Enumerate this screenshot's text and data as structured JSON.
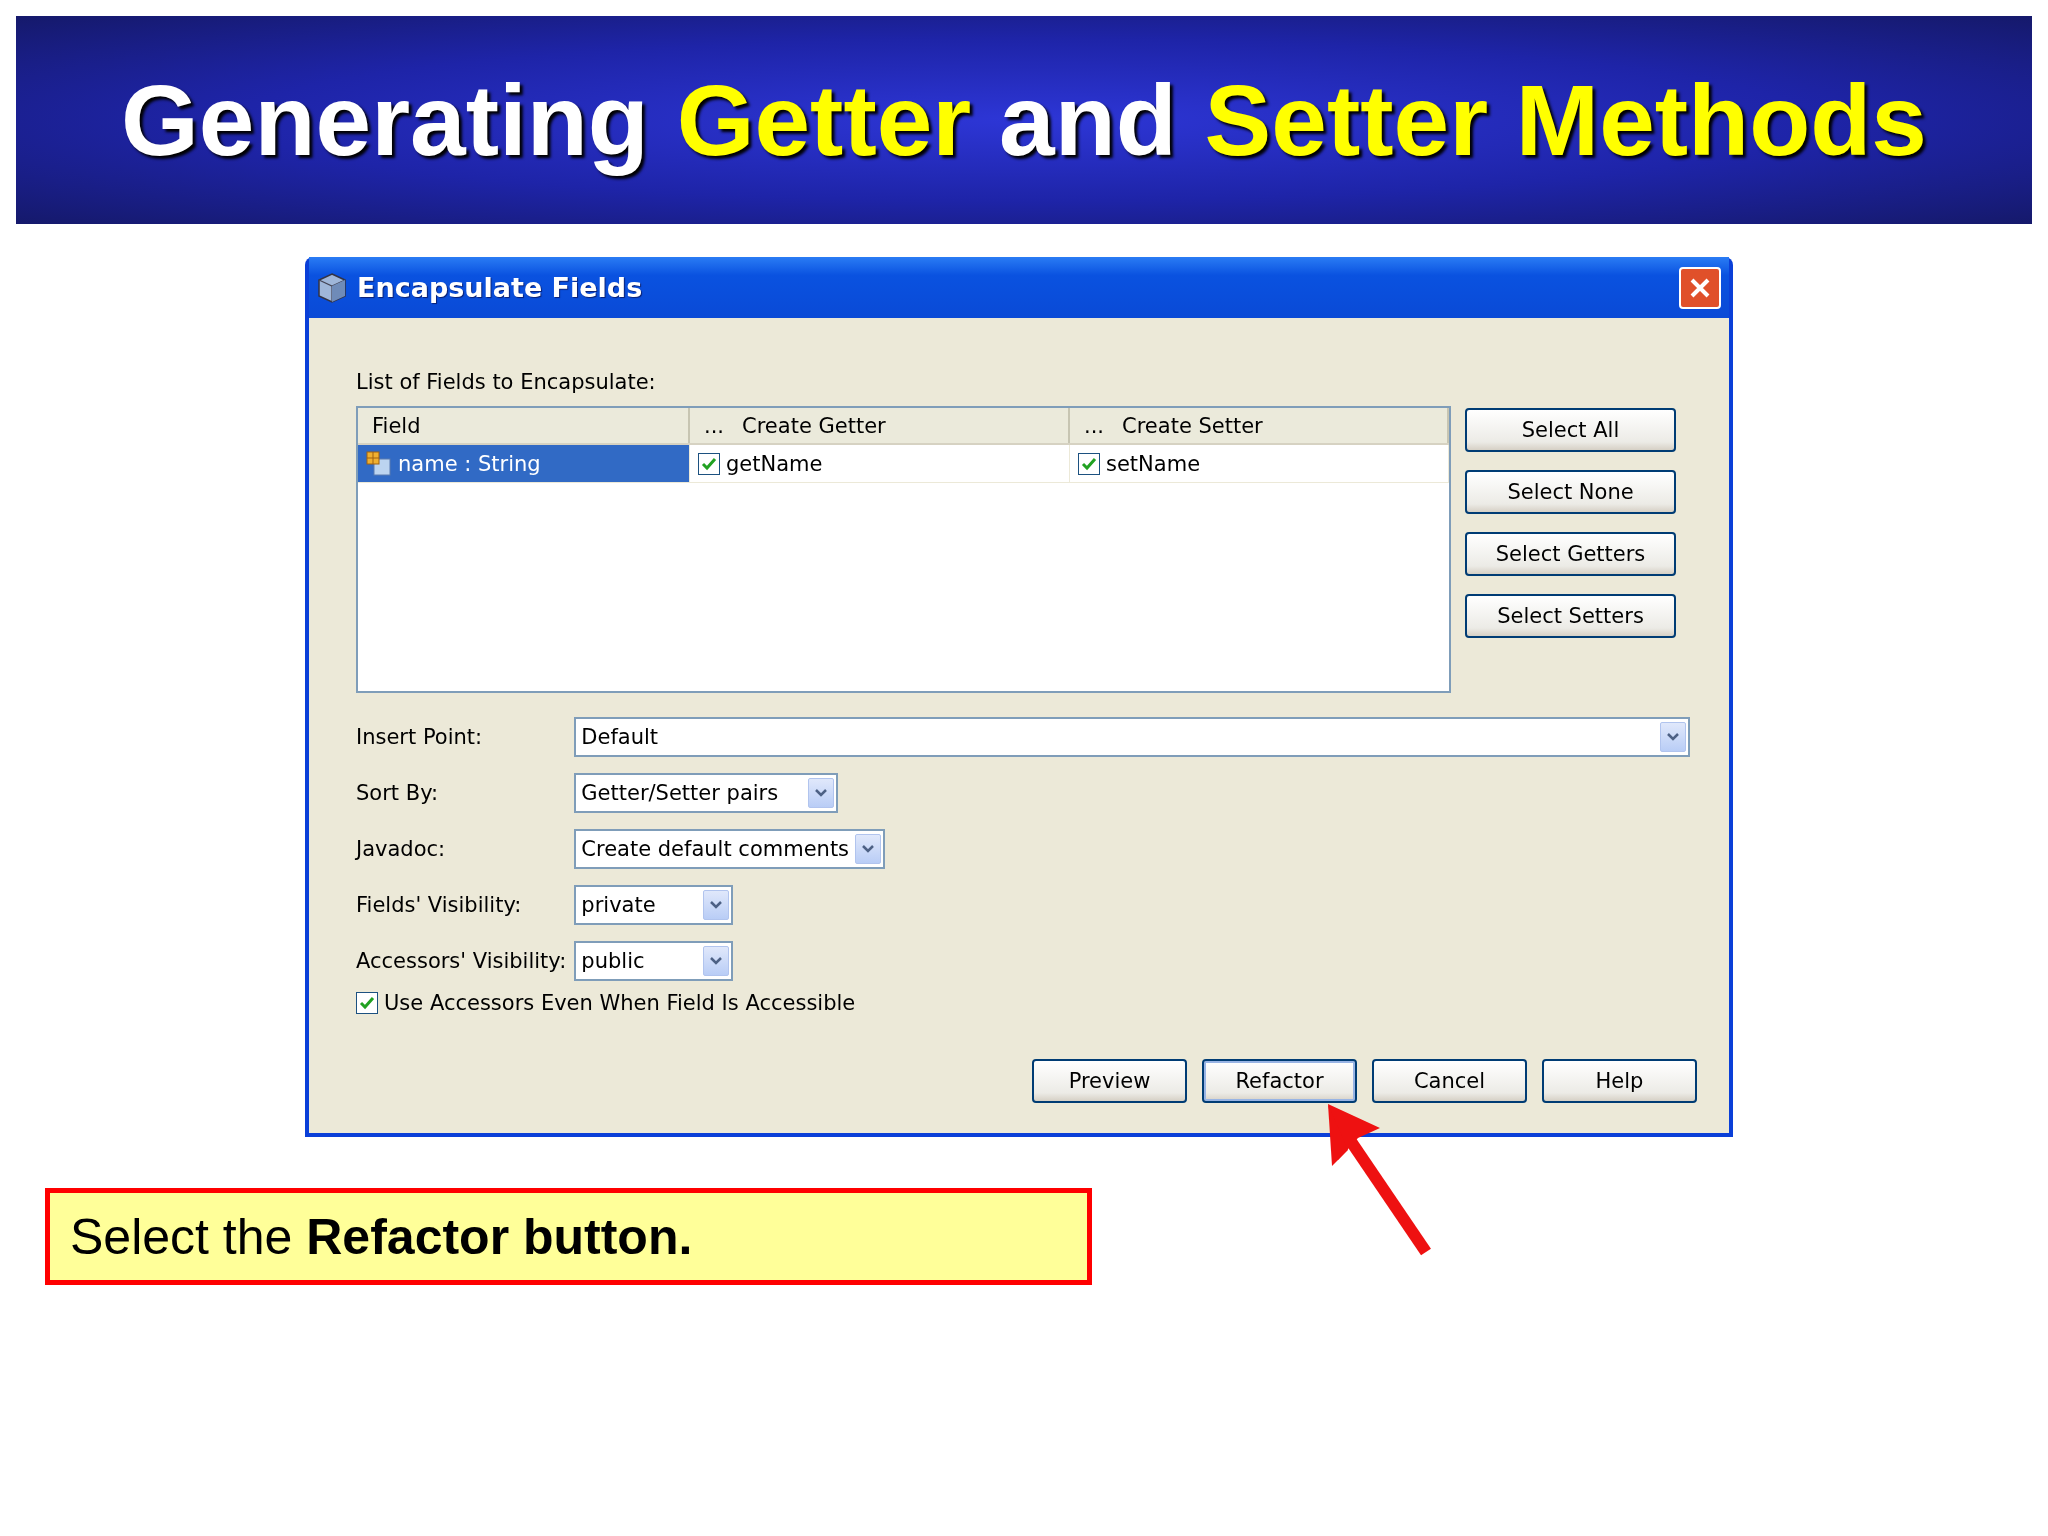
{
  "slide_title": [
    {
      "text": "Generating ",
      "highlight": false
    },
    {
      "text": "Getter",
      "highlight": true
    },
    {
      "text": " and ",
      "highlight": false
    },
    {
      "text": "Setter Methods",
      "highlight": true
    }
  ],
  "dialog": {
    "title": "Encapsulate Fields",
    "list_label": "List of Fields to Encapsulate:",
    "table": {
      "columns": [
        {
          "label": "Field"
        },
        {
          "menu": "...",
          "label": "Create Getter"
        },
        {
          "menu": "...",
          "label": "Create Setter"
        }
      ],
      "rows": [
        {
          "field": "name : String",
          "selected": true,
          "getter": {
            "checked": true,
            "name": "getName"
          },
          "setter": {
            "checked": true,
            "name": "setName"
          }
        }
      ]
    },
    "side_buttons": [
      "Select All",
      "Select None",
      "Select Getters",
      "Select Setters"
    ],
    "form": [
      {
        "label": "Insert Point:",
        "value": "Default"
      },
      {
        "label": "Sort By:",
        "value": "Getter/Setter pairs"
      },
      {
        "label": "Javadoc:",
        "value": "Create default comments"
      },
      {
        "label": "Fields' Visibility:",
        "value": "private"
      },
      {
        "label": "Accessors' Visibility:",
        "value": "public"
      }
    ],
    "option": {
      "label": "Use Accessors Even When Field Is Accessible",
      "checked": true
    },
    "buttons": [
      {
        "label": "Preview",
        "focused": false
      },
      {
        "label": "Refactor",
        "focused": true
      },
      {
        "label": "Cancel",
        "focused": false
      },
      {
        "label": "Help",
        "focused": false
      }
    ]
  },
  "caption": "Select the **Refactor button.**"
}
